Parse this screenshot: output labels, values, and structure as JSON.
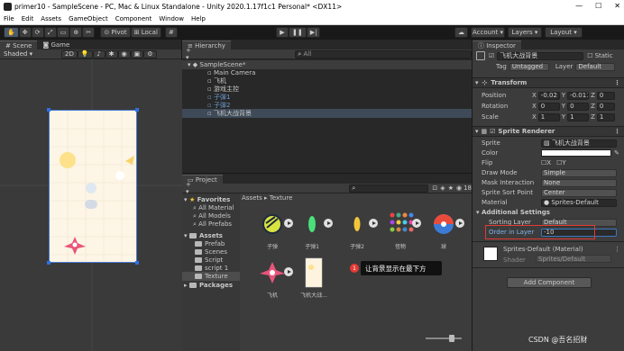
{
  "window": {
    "title": "primer10 - SampleScene - PC, Mac & Linux Standalone - Unity 2020.1.17f1c1 Personal* <DX11>",
    "controls": [
      "—",
      "☐",
      "✕"
    ]
  },
  "menu": [
    "File",
    "Edit",
    "Assets",
    "GameObject",
    "Component",
    "Window",
    "Help"
  ],
  "toolbar": {
    "pivot": "Pivot",
    "local": "Local",
    "account": "Account",
    "layers": "Layers",
    "layout": "Layout"
  },
  "scene": {
    "tabs": [
      "Scene",
      "Game"
    ],
    "shading": "Shaded",
    "mode_2d": "2D"
  },
  "hierarchy": {
    "tab": "Hierarchy",
    "search_placeholder": "All",
    "scene_name": "SampleScene*",
    "items": [
      "Main Camera",
      "飞机",
      "游戏主控",
      "子弹1",
      "子弹2",
      "飞机大战背景"
    ]
  },
  "project": {
    "tab": "Project",
    "count": "18",
    "favorites_label": "Favorites",
    "favorites": [
      "All Material",
      "All Models",
      "All Prefabs"
    ],
    "assets_label": "Assets",
    "assets_tree": [
      "Prefab",
      "Scenes",
      "Script",
      "script 1",
      "Texture"
    ],
    "packages_label": "Packages",
    "breadcrumb": [
      "Assets",
      "Texture"
    ],
    "files": [
      "子弹",
      "子弹1",
      "子弹2",
      "怪物",
      "球",
      "飞机",
      "飞机大战..."
    ]
  },
  "annotation": {
    "number": "1",
    "text": "让背景显示在最下方"
  },
  "inspector": {
    "tab": "Inspector",
    "object_name": "飞机大战背景",
    "static_label": "Static",
    "tag_label": "Tag",
    "tag_value": "Untagged",
    "layer_label": "Layer",
    "layer_value": "Default",
    "transform": {
      "title": "Transform",
      "position_label": "Position",
      "position": [
        "-0.02",
        "-0.0115",
        "0"
      ],
      "rotation_label": "Rotation",
      "rotation": [
        "0",
        "0",
        "0"
      ],
      "scale_label": "Scale",
      "scale": [
        "1",
        "1",
        "1"
      ]
    },
    "sprite_renderer": {
      "title": "Sprite Renderer",
      "sprite_label": "Sprite",
      "sprite_value": "飞机大战背景",
      "color_label": "Color",
      "flip_label": "Flip",
      "flip_x": "X",
      "flip_y": "Y",
      "draw_mode_label": "Draw Mode",
      "draw_mode_value": "Simple",
      "mask_label": "Mask Interaction",
      "mask_value": "None",
      "sort_point_label": "Sprite Sort Point",
      "sort_point_value": "Center",
      "material_label": "Material",
      "material_value": "Sprites-Default",
      "additional_label": "Additional Settings",
      "sorting_layer_label": "Sorting Layer",
      "sorting_layer_value": "Default",
      "order_label": "Order in Layer",
      "order_value": "-10"
    },
    "material_section": {
      "title": "Sprites-Default (Material)",
      "shader_label": "Shader",
      "shader_value": "Sprites/Default"
    },
    "add_component": "Add Component"
  },
  "watermark": "CSDN @吾名招财",
  "colors": {
    "highlight_box": "#e53935",
    "annotation_badge": "#e53935",
    "selection": "#2c5d87"
  }
}
